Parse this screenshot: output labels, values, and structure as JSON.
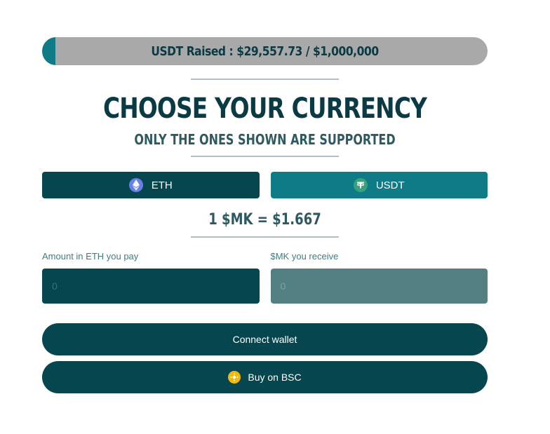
{
  "progress": {
    "label": "USDT Raised : $29,557.73 / $1,000,000",
    "raised": 29557.73,
    "goal": 1000000,
    "fill_color": "#0e7b86",
    "track_color": "#a9a9a9"
  },
  "heading": {
    "title": "CHOOSE YOUR CURRENCY",
    "subtitle": "ONLY THE ONES SHOWN ARE SUPPORTED"
  },
  "currency_tabs": [
    {
      "label": "ETH",
      "icon": "ethereum-icon",
      "selected": true
    },
    {
      "label": "USDT",
      "icon": "tether-icon",
      "selected": false
    }
  ],
  "rate": "1 $MK = $1.667",
  "pay_field": {
    "label": "Amount in ETH you pay",
    "placeholder": "0"
  },
  "receive_field": {
    "label": "$MK you receive",
    "placeholder": "0"
  },
  "buttons": {
    "connect": "Connect wallet",
    "bsc": "Buy on BSC",
    "bsc_icon": "bnb-icon"
  },
  "colors": {
    "primary_dark": "#06474f",
    "accent_teal": "#0e7b86",
    "text_dark": "#0a3a44"
  }
}
